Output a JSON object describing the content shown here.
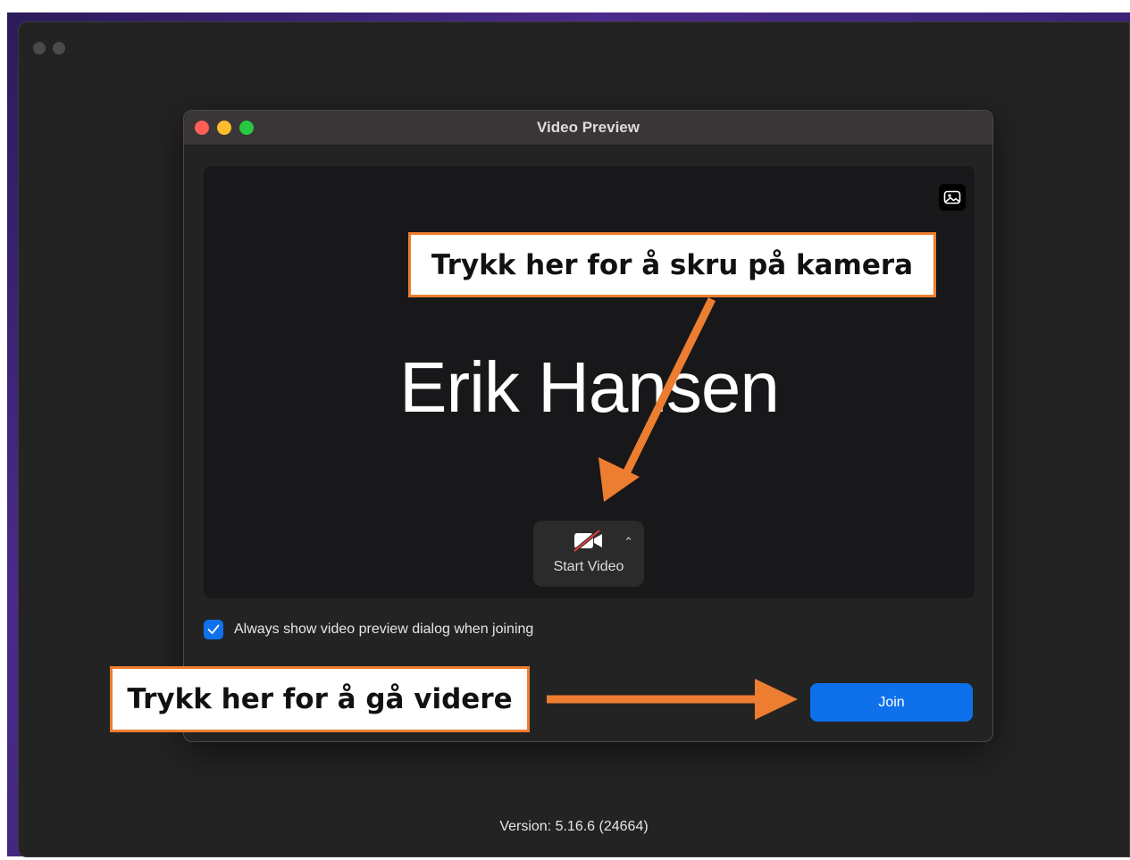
{
  "dialog": {
    "title": "Video Preview",
    "user_name": "Erik Hansen",
    "start_video_label": "Start Video",
    "checkbox_label": "Always show video preview dialog when joining",
    "checkbox_checked": true,
    "join_label": "Join"
  },
  "footer": {
    "version": "Version: 5.16.6 (24664)"
  },
  "annotations": {
    "camera_hint": "Trykk her for å skru på kamera",
    "join_hint": "Trykk her for å gå videre"
  },
  "icons": {
    "background_button": "image-icon",
    "camera": "video-off-icon",
    "caret": "chevron-up-icon",
    "checkmark": "checkmark-icon"
  },
  "colors": {
    "accent": "#0e71eb",
    "callout_border": "#ed7d31",
    "arrow": "#ed7d31",
    "window_bg": "#232323",
    "preview_bg": "#18181a"
  }
}
